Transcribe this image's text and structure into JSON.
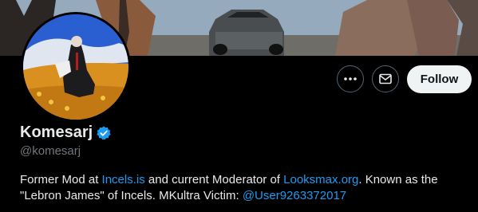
{
  "profile": {
    "name": "Komesarj",
    "handle": "@komesarj",
    "verified": true,
    "verified_color": "#1d9bf0"
  },
  "actions": {
    "more_icon": "more-horizontal-icon",
    "message_icon": "envelope-icon",
    "follow_label": "Follow"
  },
  "bio": {
    "t1": "Former Mod at ",
    "link1": "Incels.is",
    "t2": " and current Moderator of ",
    "link2": "Looksmax.org",
    "t3": ". Known as the \"Lebron James\" of Incels. MKultra Victim: ",
    "mention": "@User9263372017"
  },
  "colors": {
    "background": "#000000",
    "text": "#e7e9ea",
    "secondary_text": "#71767b",
    "link": "#1d9bf0",
    "follow_bg": "#eff3f4"
  }
}
